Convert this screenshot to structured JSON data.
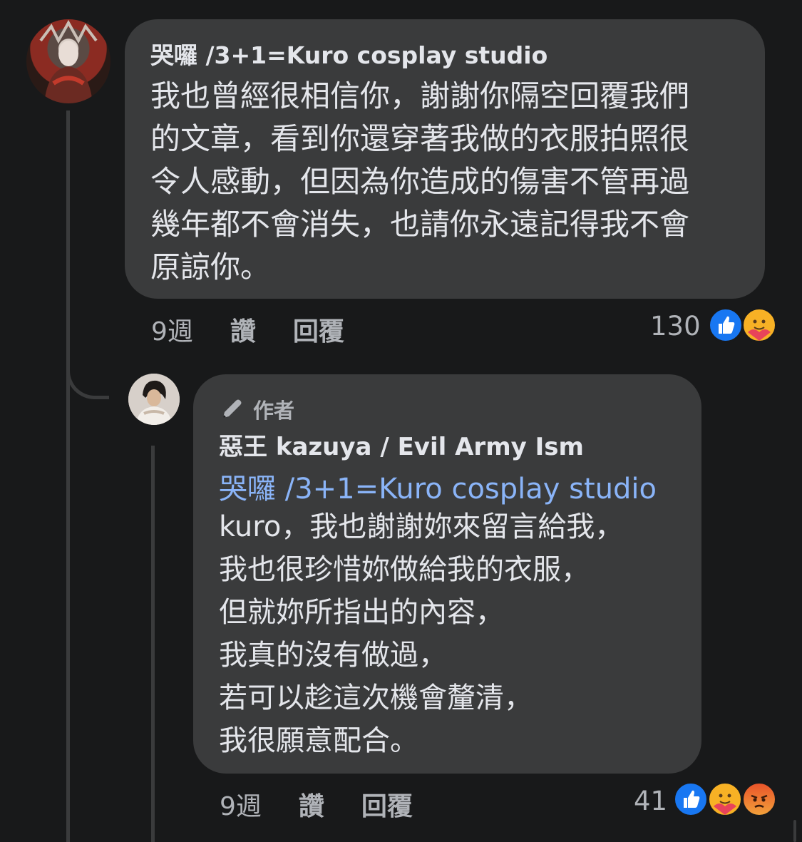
{
  "comment": {
    "author": "哭囉 /3+1=Kuro cosplay studio",
    "text": "我也曾經很相信你，謝謝你隔空回覆我們\n的文章，看到你還穿著我做的衣服拍照很\n令人感動，但因為你造成的傷害不管再過\n幾年都不會消失，也請你永遠記得我不會\n原諒你。",
    "time": "9週",
    "like_label": "讚",
    "reply_label": "回覆",
    "reaction_count": "130",
    "reactions": [
      "like-icon",
      "care-icon"
    ]
  },
  "reply": {
    "badge_label": "作者",
    "author": "惡王 kazuya / Evil Army Ism",
    "mention": "哭囉 /3+1=Kuro cosplay studio",
    "text": "kuro，我也謝謝妳來留言給我，\n我也很珍惜妳做給我的衣服，\n但就妳所指出的內容，\n我真的沒有做過，\n若可以趁這次機會釐清，\n我很願意配合。",
    "time": "9週",
    "like_label": "讚",
    "reply_label": "回覆",
    "reaction_count": "41",
    "reactions": [
      "like-icon",
      "care-icon",
      "angry-icon"
    ]
  },
  "colors": {
    "background": "#18191a",
    "bubble": "#3a3b3c",
    "mention": "#8ab4f8",
    "like_blue": "#1877f2"
  }
}
